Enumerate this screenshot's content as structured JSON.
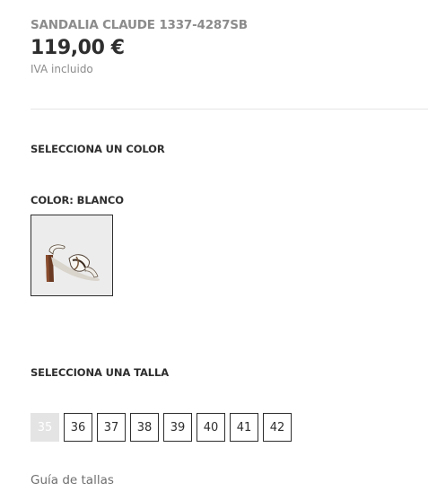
{
  "product": {
    "name": "SANDALIA CLAUDE 1337-4287SB",
    "price": "119,00 €",
    "tax_note": "IVA incluido"
  },
  "color_section": {
    "heading": "SELECCIONA UN COLOR",
    "selected_label": "COLOR: BLANCO",
    "swatch_icon": "sandal-thumbnail"
  },
  "size_section": {
    "heading": "SELECCIONA UNA TALLA",
    "sizes": [
      {
        "label": "35",
        "available": false
      },
      {
        "label": "36",
        "available": true
      },
      {
        "label": "37",
        "available": true
      },
      {
        "label": "38",
        "available": true
      },
      {
        "label": "39",
        "available": true
      },
      {
        "label": "40",
        "available": true
      },
      {
        "label": "41",
        "available": true
      },
      {
        "label": "42",
        "available": true
      }
    ]
  },
  "size_guide": {
    "label": "Guía de tallas"
  },
  "colors": {
    "text_dark": "#2e2e2e",
    "text_muted": "#8c8c8c",
    "disabled_bg": "#e4e4e4",
    "divider": "#e6e6e6"
  }
}
